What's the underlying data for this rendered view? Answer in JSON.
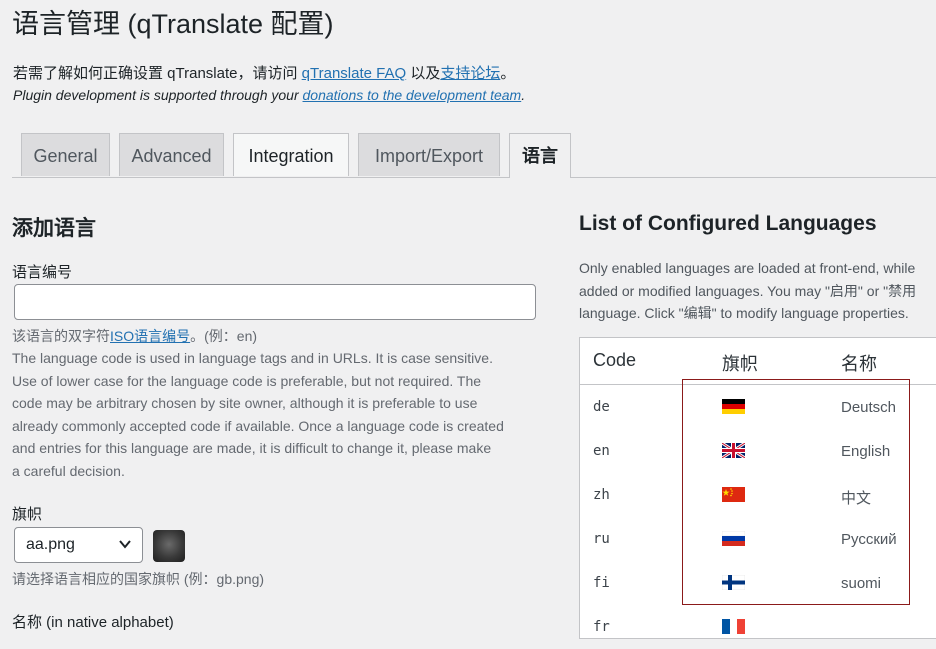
{
  "page_title": "语言管理 (qTranslate 配置)",
  "intro": {
    "prefix": "若需了解如何正确设置 qTranslate，请访问 ",
    "faq_link": "qTranslate FAQ",
    "middle": " 以及",
    "forum_link": "支持论坛",
    "suffix": "。"
  },
  "intro2": {
    "prefix": "Plugin development is supported through your ",
    "link": "donations to the development team",
    "suffix": "."
  },
  "tabs": [
    {
      "label": "General"
    },
    {
      "label": "Advanced"
    },
    {
      "label": "Integration"
    },
    {
      "label": "Import/Export"
    },
    {
      "label": "语言"
    }
  ],
  "add_language": {
    "heading": "添加语言",
    "code_label": "语言编号",
    "code_value": "",
    "code_hint_prefix": "该语言的双字符",
    "code_hint_link": "ISO语言编号",
    "code_hint_suffix": "。(例：en)",
    "code_desc_lines": [
      "The language code is used in language tags and in URLs. It is case sensitive.",
      "Use of lower case for the language code is preferable, but not required. The",
      "code may be arbitrary chosen by site owner, although it is preferable to use",
      "already commonly accepted code if available. Once a language code is created",
      "and entries for this language are made, it is difficult to change it, please make",
      "a careful decision."
    ],
    "flag_label": "旗帜",
    "flag_selected": "aa.png",
    "flag_hint": "请选择语言相应的国家旗帜 (例：gb.png)",
    "name_label": "名称 (in native alphabet)"
  },
  "configured": {
    "heading": "List of Configured Languages",
    "desc_lines": [
      "Only enabled languages are loaded at front-end, while",
      "added or modified languages. You may \"启用\" or \"禁用",
      "language. Click \"编辑\" to modify language properties."
    ],
    "columns": {
      "code": "Code",
      "flag": "旗帜",
      "name": "名称"
    },
    "rows": [
      {
        "code": "de",
        "name": "Deutsch",
        "flag": "germany-flag"
      },
      {
        "code": "en",
        "name": "English",
        "flag": "uk-flag"
      },
      {
        "code": "zh",
        "name": "中文",
        "flag": "china-flag"
      },
      {
        "code": "ru",
        "name": "Русский",
        "flag": "russia-flag"
      },
      {
        "code": "fi",
        "name": "suomi",
        "flag": "finland-flag"
      },
      {
        "code": "fr",
        "name": "",
        "flag": "france-flag"
      }
    ]
  },
  "colors": {
    "link": "#2271b1",
    "background": "#f0f0f1",
    "annotation": "#8b1a1a"
  }
}
